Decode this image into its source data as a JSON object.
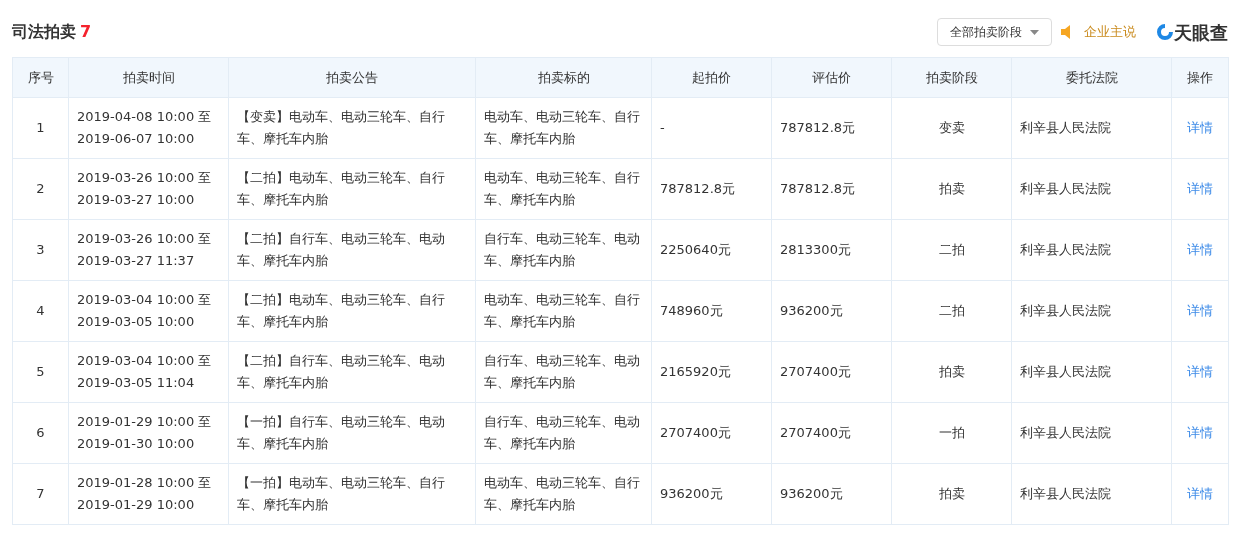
{
  "title": "司法拍卖",
  "count": "7",
  "filter": {
    "label": "全部拍卖阶段"
  },
  "promo": {
    "label": "企业主说"
  },
  "brand": {
    "label": "天眼查"
  },
  "table": {
    "columns": [
      "序号",
      "拍卖时间",
      "拍卖公告",
      "拍卖标的",
      "起拍价",
      "评估价",
      "拍卖阶段",
      "委托法院",
      "操作"
    ],
    "rows": [
      {
        "index": "1",
        "time": "2019-04-08 10:00 至 2019-06-07 10:00",
        "notice": "【变卖】电动车、电动三轮车、自行车、摩托车内胎",
        "subject": "电动车、电动三轮车、自行车、摩托车内胎",
        "start_price": "-",
        "appraisal": "787812.8元",
        "stage": "变卖",
        "court": "利辛县人民法院",
        "action": "详情"
      },
      {
        "index": "2",
        "time": "2019-03-26 10:00 至 2019-03-27 10:00",
        "notice": "【二拍】电动车、电动三轮车、自行车、摩托车内胎",
        "subject": "电动车、电动三轮车、自行车、摩托车内胎",
        "start_price": "787812.8元",
        "appraisal": "787812.8元",
        "stage": "拍卖",
        "court": "利辛县人民法院",
        "action": "详情"
      },
      {
        "index": "3",
        "time": "2019-03-26 10:00 至 2019-03-27 11:37",
        "notice": "【二拍】自行车、电动三轮车、电动车、摩托车内胎",
        "subject": "自行车、电动三轮车、电动车、摩托车内胎",
        "start_price": "2250640元",
        "appraisal": "2813300元",
        "stage": "二拍",
        "court": "利辛县人民法院",
        "action": "详情"
      },
      {
        "index": "4",
        "time": "2019-03-04 10:00 至 2019-03-05 10:00",
        "notice": "【二拍】电动车、电动三轮车、自行车、摩托车内胎",
        "subject": "电动车、电动三轮车、自行车、摩托车内胎",
        "start_price": "748960元",
        "appraisal": "936200元",
        "stage": "二拍",
        "court": "利辛县人民法院",
        "action": "详情"
      },
      {
        "index": "5",
        "time": "2019-03-04 10:00 至 2019-03-05 11:04",
        "notice": "【二拍】自行车、电动三轮车、电动车、摩托车内胎",
        "subject": "自行车、电动三轮车、电动车、摩托车内胎",
        "start_price": "2165920元",
        "appraisal": "2707400元",
        "stage": "拍卖",
        "court": "利辛县人民法院",
        "action": "详情"
      },
      {
        "index": "6",
        "time": "2019-01-29 10:00 至 2019-01-30 10:00",
        "notice": "【一拍】自行车、电动三轮车、电动车、摩托车内胎",
        "subject": "自行车、电动三轮车、电动车、摩托车内胎",
        "start_price": "2707400元",
        "appraisal": "2707400元",
        "stage": "一拍",
        "court": "利辛县人民法院",
        "action": "详情"
      },
      {
        "index": "7",
        "time": "2019-01-28 10:00 至 2019-01-29 10:00",
        "notice": "【一拍】电动车、电动三轮车、自行车、摩托车内胎",
        "subject": "电动车、电动三轮车、自行车、摩托车内胎",
        "start_price": "936200元",
        "appraisal": "936200元",
        "stage": "拍卖",
        "court": "利辛县人民法院",
        "action": "详情"
      }
    ]
  }
}
